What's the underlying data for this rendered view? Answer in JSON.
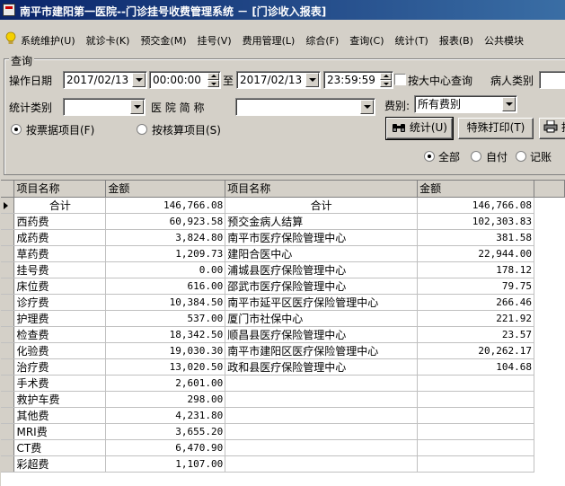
{
  "window": {
    "title": "南平市建阳第一医院--门诊挂号收费管理系统 － [门诊收入报表]"
  },
  "menu": [
    "系统维护(U)",
    "就诊卡(K)",
    "预交金(M)",
    "挂号(V)",
    "费用管理(L)",
    "综合(F)",
    "查询(C)",
    "统计(T)",
    "报表(B)",
    "公共模块"
  ],
  "form": {
    "group_label": "查询",
    "date_label": "操作日期",
    "start_date": "2017/02/13",
    "start_time": "00:00:00",
    "to_label": "至",
    "end_date": "2017/02/13",
    "end_time": "23:59:59",
    "center_query_label": "按大中心查询",
    "patient_type_label": "病人类别",
    "stat_type_label": "统计类别",
    "hospital_label": "医 院 简 称",
    "fee_type_label": "费别:",
    "fee_type_value": "所有费别",
    "radio_ticket": "按票据项目(F)",
    "radio_settle": "按核算项目(S)",
    "btn_stat": "统计(U)",
    "btn_special_print": "特殊打印(T)",
    "btn_print_partial": "打",
    "pay_all": "全部",
    "pay_self": "自付",
    "pay_account": "记账"
  },
  "table": {
    "headers": [
      "项目名称",
      "金额",
      "项目名称",
      "金额"
    ],
    "rows": [
      [
        "合计",
        "146,766.08",
        "合计",
        "146,766.08"
      ],
      [
        "西药费",
        "60,923.58",
        "预交金病人结算",
        "102,303.83"
      ],
      [
        "成药费",
        "3,824.80",
        "南平市医疗保险管理中心",
        "381.58"
      ],
      [
        "草药费",
        "1,209.73",
        "建阳合医中心",
        "22,944.00"
      ],
      [
        "挂号费",
        "0.00",
        "浦城县医疗保险管理中心",
        "178.12"
      ],
      [
        "床位费",
        "616.00",
        "邵武市医疗保险管理中心",
        "79.75"
      ],
      [
        "诊疗费",
        "10,384.50",
        "南平市延平区医疗保险管理中心",
        "266.46"
      ],
      [
        "护理费",
        "537.00",
        "厦门市社保中心",
        "221.92"
      ],
      [
        "检查费",
        "18,342.50",
        "顺昌县医疗保险管理中心",
        "23.57"
      ],
      [
        "化验费",
        "19,030.30",
        "南平市建阳区医疗保险管理中心",
        "20,262.17"
      ],
      [
        "治疗费",
        "13,020.50",
        "政和县医疗保险管理中心",
        "104.68"
      ],
      [
        "手术费",
        "2,601.00",
        "",
        ""
      ],
      [
        "救护车费",
        "298.00",
        "",
        ""
      ],
      [
        "其他费",
        "4,231.80",
        "",
        ""
      ],
      [
        "MRI费",
        "3,655.20",
        "",
        ""
      ],
      [
        "CT费",
        "6,470.90",
        "",
        ""
      ],
      [
        "彩超费",
        "1,107.00",
        "",
        ""
      ]
    ]
  }
}
